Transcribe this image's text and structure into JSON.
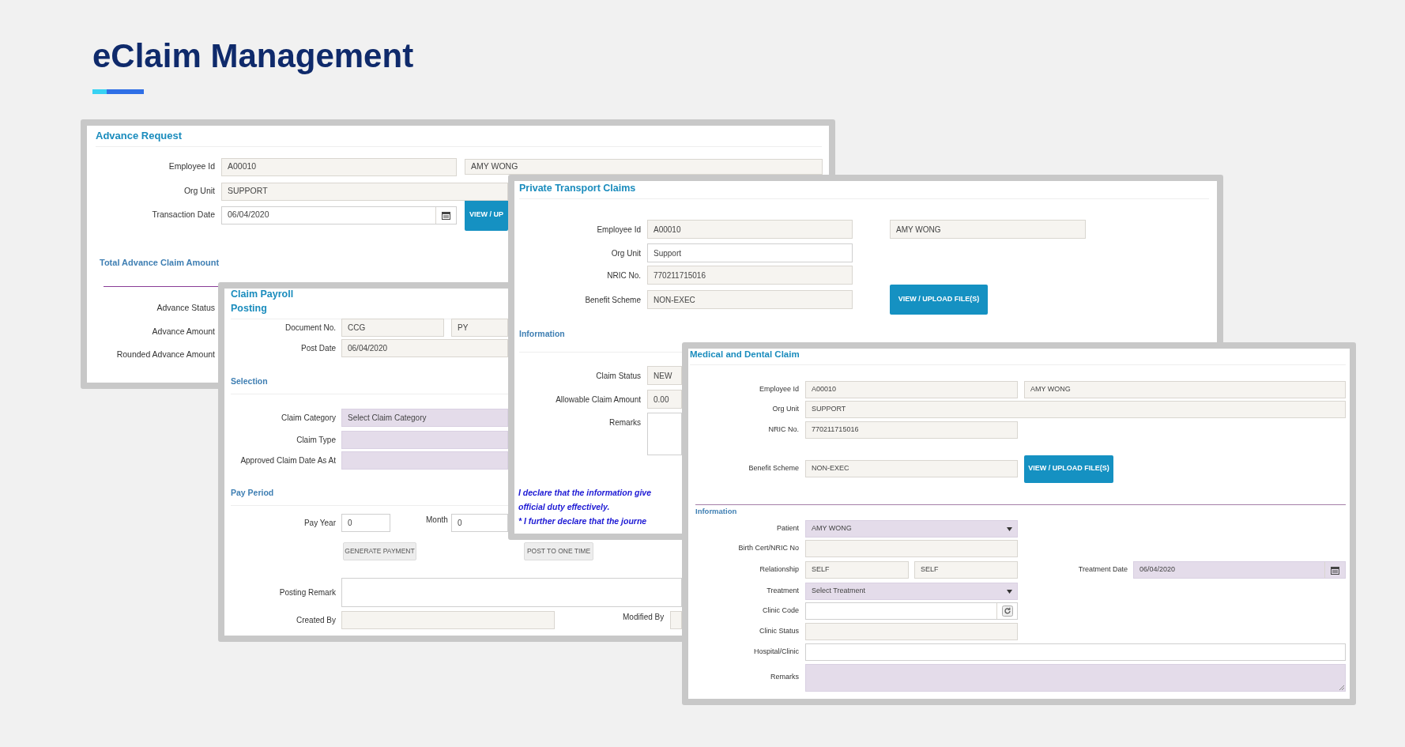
{
  "page_title": "eClaim Management",
  "windows": [
    {
      "title": "Advance Request",
      "rows": [
        {
          "kind": "field",
          "label": "Employee Id",
          "fields": [
            {
              "kind": "readonly",
              "value": "A00010",
              "required": false
            },
            {
              "kind": "readonly",
              "value": "AMY WONG",
              "required": false
            }
          ]
        },
        {
          "kind": "field",
          "label": "Org Unit",
          "fields": [
            {
              "kind": "readonly",
              "value": "SUPPORT",
              "required": false
            }
          ]
        },
        {
          "kind": "field",
          "label": "Transaction Date",
          "fields": [
            {
              "kind": "date",
              "value": "06/04/2020",
              "required": false
            },
            {
              "kind": "primary",
              "label": "VIEW / UP"
            }
          ]
        },
        {
          "kind": "heading",
          "text": "Total Advance Claim Amount"
        },
        {
          "kind": "field",
          "label": "Advance Status"
        },
        {
          "kind": "field",
          "label": "Advance Amount"
        },
        {
          "kind": "field",
          "label": "Rounded Advance Amount"
        }
      ]
    },
    {
      "title": "Claim Payroll Posting",
      "rows": [
        {
          "kind": "field",
          "label": "Document No.",
          "fields": [
            {
              "kind": "readonly",
              "value": "CCG",
              "required": false
            },
            {
              "kind": "readonly",
              "value": "PY",
              "required": false
            }
          ]
        },
        {
          "kind": "field",
          "label": "Post Date",
          "fields": [
            {
              "kind": "readonly",
              "value": "06/04/2020",
              "required": false
            }
          ]
        },
        {
          "kind": "heading",
          "text": "Selection"
        },
        {
          "kind": "field",
          "label": "Claim Category",
          "fields": [
            {
              "kind": "select",
              "value": "Select Claim Category",
              "required": true
            }
          ]
        },
        {
          "kind": "field",
          "label": "Claim Type",
          "fields": [
            {
              "kind": "select",
              "required": true
            }
          ]
        },
        {
          "kind": "field",
          "label": "Approved Claim Date As At",
          "fields": [
            {
              "kind": "text",
              "required": true
            }
          ]
        },
        {
          "kind": "heading",
          "text": "Pay Period"
        },
        {
          "kind": "field",
          "label": "Pay Year",
          "fields": [
            {
              "kind": "text",
              "value": "0",
              "required": false
            },
            {
              "kind": "label",
              "text": "Month"
            },
            {
              "kind": "text",
              "value": "0",
              "required": false
            }
          ]
        },
        {
          "kind": "field",
          "fields": [
            {
              "kind": "secondary",
              "label": "GENERATE PAYMENT"
            },
            {
              "kind": "secondary",
              "label": "POST TO ONE TIME"
            }
          ]
        },
        {
          "kind": "field",
          "label": "Posting Remark",
          "fields": [
            {
              "kind": "textarea",
              "required": false
            }
          ]
        },
        {
          "kind": "field",
          "label": "Created By",
          "fields": [
            {
              "kind": "readonly",
              "required": false
            },
            {
              "kind": "label",
              "text": "Modified By"
            },
            {
              "kind": "readonly",
              "required": false
            }
          ]
        }
      ]
    },
    {
      "title": "Private Transport Claims",
      "rows": [
        {
          "kind": "field",
          "label": "Employee Id",
          "fields": [
            {
              "kind": "readonly",
              "value": "A00010",
              "required": false
            },
            {
              "kind": "readonly",
              "value": "AMY WONG",
              "required": false
            }
          ]
        },
        {
          "kind": "field",
          "label": "Org Unit",
          "fields": [
            {
              "kind": "text",
              "value": "Support",
              "required": false
            }
          ]
        },
        {
          "kind": "field",
          "label": "NRIC No.",
          "fields": [
            {
              "kind": "readonly",
              "value": "770211715016",
              "required": false
            }
          ]
        },
        {
          "kind": "field",
          "label": "Benefit Scheme",
          "fields": [
            {
              "kind": "readonly",
              "value": "NON-EXEC",
              "required": false
            },
            {
              "kind": "primary",
              "label": "VIEW / UPLOAD FILE(S)"
            }
          ]
        },
        {
          "kind": "heading",
          "text": "Information"
        },
        {
          "kind": "field",
          "label": "Claim Status",
          "fields": [
            {
              "kind": "readonly",
              "value": "NEW",
              "required": false
            }
          ]
        },
        {
          "kind": "field",
          "label": "Allowable Claim Amount",
          "fields": [
            {
              "kind": "readonly",
              "value": "0.00",
              "required": false
            }
          ]
        },
        {
          "kind": "field",
          "label": "Remarks",
          "fields": [
            {
              "kind": "textarea",
              "required": false
            }
          ]
        },
        {
          "kind": "declaration",
          "lines": [
            "I declare that the information give",
            "official duty effectively.",
            "* I further declare that the journe"
          ]
        }
      ]
    },
    {
      "title": "Medical and Dental Claim",
      "rows": [
        {
          "kind": "field",
          "label": "Employee Id",
          "fields": [
            {
              "kind": "readonly",
              "value": "A00010",
              "required": false
            },
            {
              "kind": "readonly",
              "value": "AMY WONG",
              "required": false
            }
          ]
        },
        {
          "kind": "field",
          "label": "Org Unit",
          "fields": [
            {
              "kind": "readonly",
              "value": "SUPPORT",
              "required": false
            }
          ]
        },
        {
          "kind": "field",
          "label": "NRIC No.",
          "fields": [
            {
              "kind": "readonly",
              "value": "770211715016",
              "required": false
            }
          ]
        },
        {
          "kind": "field",
          "label": "Benefit Scheme",
          "fields": [
            {
              "kind": "readonly",
              "value": "NON-EXEC",
              "required": false
            },
            {
              "kind": "primary",
              "label": "VIEW / UPLOAD FILE(S)"
            }
          ]
        },
        {
          "kind": "heading",
          "text": "Information"
        },
        {
          "kind": "field",
          "label": "Patient",
          "fields": [
            {
              "kind": "select",
              "value": "AMY WONG",
              "required": true
            }
          ]
        },
        {
          "kind": "field",
          "label": "Birth Cert/NRIC No",
          "fields": [
            {
              "kind": "readonly",
              "required": false
            }
          ]
        },
        {
          "kind": "field",
          "label": "Relationship",
          "fields": [
            {
              "kind": "readonly",
              "value": "SELF",
              "required": false
            },
            {
              "kind": "readonly",
              "value": "SELF",
              "required": false
            },
            {
              "kind": "label",
              "text": "Treatment Date"
            },
            {
              "kind": "date",
              "value": "06/04/2020",
              "required": true
            }
          ]
        },
        {
          "kind": "field",
          "label": "Treatment",
          "fields": [
            {
              "kind": "select",
              "value": "Select Treatment",
              "required": true
            }
          ]
        },
        {
          "kind": "field",
          "label": "Clinic Code",
          "fields": [
            {
              "kind": "lookup",
              "required": false
            }
          ]
        },
        {
          "kind": "field",
          "label": "Clinic Status",
          "fields": [
            {
              "kind": "readonly",
              "required": false
            }
          ]
        },
        {
          "kind": "field",
          "label": "Hospital/Clinic",
          "fields": [
            {
              "kind": "text",
              "required": false
            }
          ]
        },
        {
          "kind": "field",
          "label": "Remarks",
          "fields": [
            {
              "kind": "textarea",
              "required": true
            }
          ]
        }
      ]
    }
  ]
}
